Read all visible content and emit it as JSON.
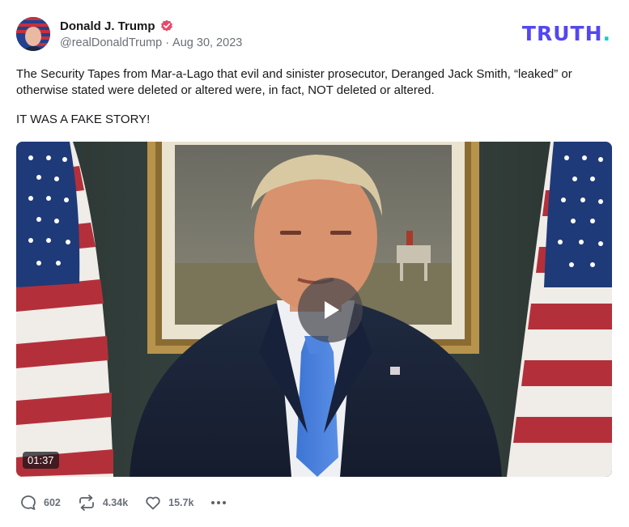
{
  "post": {
    "author": {
      "name": "Donald J. Trump",
      "handle": "@realDonaldTrump",
      "separator": "·",
      "date": "Aug 30, 2023",
      "verified_color": "#e8496b"
    },
    "brand": {
      "logo_text": "TRUTH",
      "logo_dot": ".",
      "logo_color": "#5448ee",
      "dot_color": "#0ecfc8"
    },
    "body": {
      "paragraphs": [
        "The Security Tapes from Mar-a-Lago that evil and sinister prosecutor, Deranged Jack Smith, “leaked” or otherwise stated were deleted or altered were, in fact, NOT deleted or altered.",
        "IT WAS A FAKE STORY!"
      ]
    },
    "media": {
      "type": "video",
      "duration": "01:37",
      "play_icon": "play-icon"
    },
    "actions": {
      "replies": {
        "icon": "reply-icon",
        "count": "602"
      },
      "retruths": {
        "icon": "retruth-icon",
        "count": "4.34k"
      },
      "likes": {
        "icon": "heart-icon",
        "count": "15.7k"
      },
      "more": {
        "icon": "more-icon"
      }
    }
  }
}
